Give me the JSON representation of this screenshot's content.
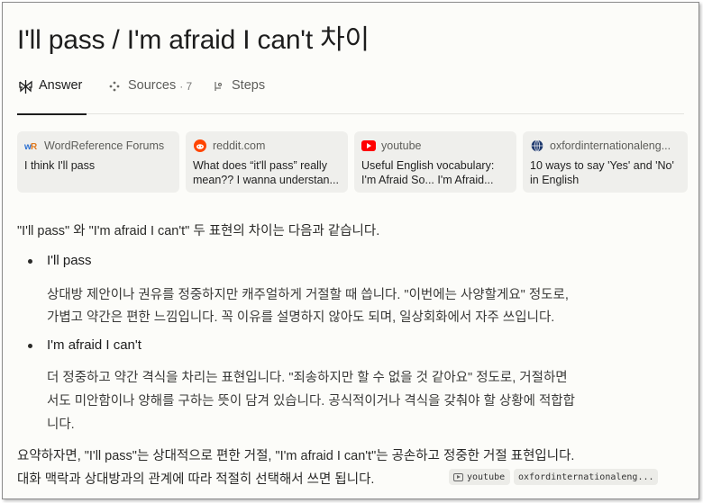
{
  "header": {
    "title": "I'll pass / I'm afraid I can't 차이"
  },
  "tabs": [
    {
      "label": "Answer"
    },
    {
      "label": "Sources",
      "count": "· 7"
    },
    {
      "label": "Steps"
    }
  ],
  "sources": [
    {
      "site": "WordReference Forums",
      "text_lines": [
        "I think I'll pass",
        ""
      ]
    },
    {
      "site": "reddit.com",
      "text_lines": [
        "What does “it'll pass” really",
        "mean?? I wanna understan..."
      ]
    },
    {
      "site": "youtube",
      "text_lines": [
        "Useful English vocabulary:",
        "I'm Afraid So... I'm Afraid..."
      ]
    },
    {
      "site": "oxfordinternationaleng...",
      "text_lines": [
        "10 ways to say 'Yes' and 'No'",
        "in English"
      ]
    }
  ],
  "answer": {
    "intro": "\"I'll pass\" 와 \"I'm afraid I can't\" 두 표현의 차이는 다음과 같습니다.",
    "bullets": [
      {
        "title": "I'll pass",
        "lines": [
          "상대방 제안이나 권유를 정중하지만 캐주얼하게 거절할 때 씁니다. \"이번에는 사양할게요\" 정도로,",
          "가볍고 약간은 편한 느낌입니다. 꼭 이유를 설명하지 않아도 되며, 일상회화에서 자주 쓰입니다."
        ]
      },
      {
        "title": "I'm afraid I can't",
        "lines": [
          "더 정중하고 약간 격식을 차리는 표현입니다. \"죄송하지만 할 수 없을 것 같아요\" 정도로, 거절하면",
          "서도 미안함이나 양해를 구하는 뜻이 담겨 있습니다. 공식적이거나 격식을 갖춰야 할 상황에 적합합",
          "니다."
        ]
      }
    ],
    "summary_lines": [
      "요약하자면, \"I'll pass\"는 상대적으로 편한 거절, \"I'm afraid I can't\"는 공손하고 정중한 거절 표현입니다.",
      "대화 맥락과 상대방과의 관계에 따라 적절히 선택해서 쓰면 됩니다."
    ],
    "citations": [
      "youtube",
      "oxfordinternationaleng..."
    ]
  }
}
